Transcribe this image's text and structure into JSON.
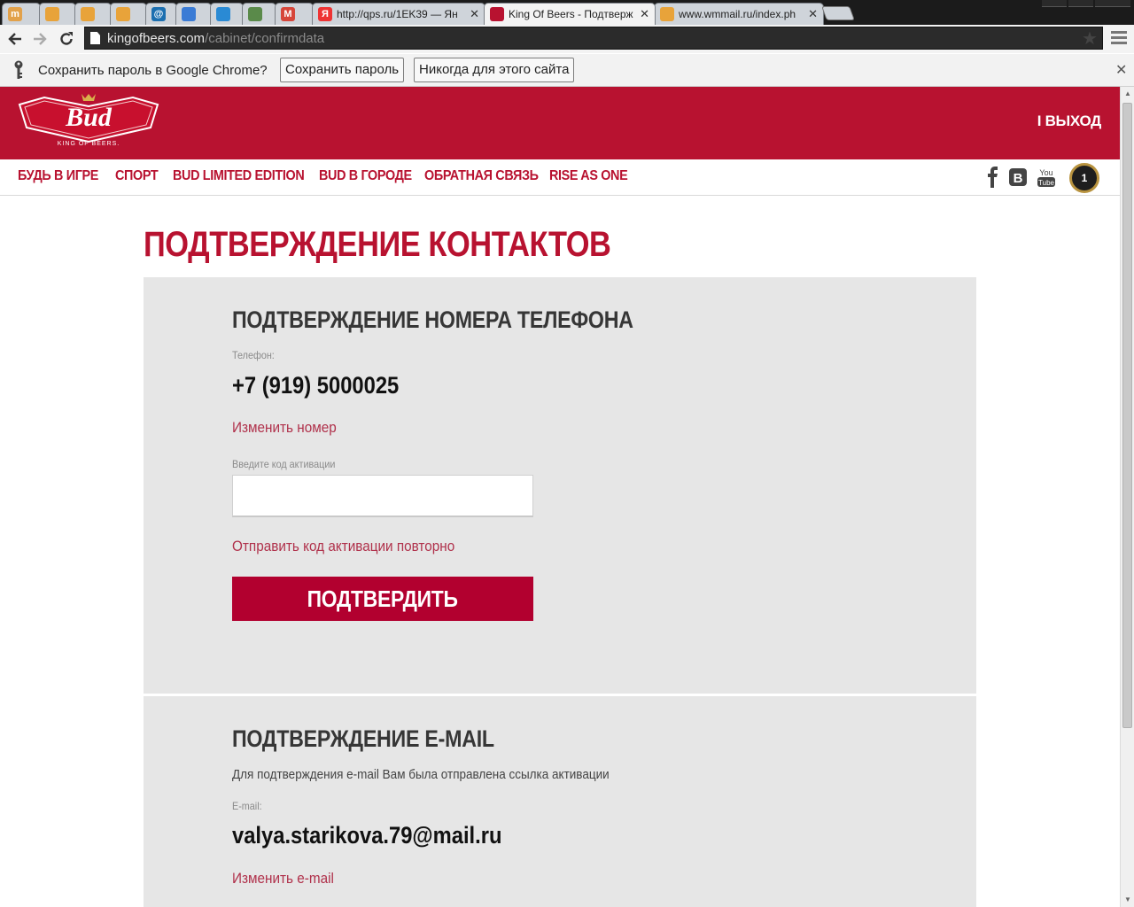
{
  "browser": {
    "tabs": [
      {
        "title": "",
        "icon_color": "#e2a14a",
        "icon_text": "m"
      },
      {
        "title": "",
        "icon_color": "#e8a33a",
        "icon_text": ""
      },
      {
        "title": "",
        "icon_color": "#e8a33a",
        "icon_text": ""
      },
      {
        "title": "",
        "icon_color": "#e8a33a",
        "icon_text": ""
      },
      {
        "title": "",
        "icon_color": "#1c6fb0",
        "icon_text": "@"
      },
      {
        "title": "",
        "icon_color": "#3a7bd5",
        "icon_text": ""
      },
      {
        "title": "",
        "icon_color": "#2a8ad4",
        "icon_text": ""
      },
      {
        "title": "",
        "icon_color": "#5a8a4a",
        "icon_text": ""
      },
      {
        "title": "",
        "icon_color": "#d6463a",
        "icon_text": "M"
      },
      {
        "title": "http://qps.ru/1EK39 — Ян",
        "icon_color": "#e33",
        "icon_text": "Я"
      },
      {
        "title": "King Of Beers - Подтверж",
        "icon_color": "#b81230",
        "icon_text": ""
      },
      {
        "title": "www.wmmail.ru/index.ph",
        "icon_color": "#e8a33a",
        "icon_text": ""
      }
    ],
    "address": {
      "host": "kingofbeers.com",
      "path": "/cabinet/confirmdata"
    },
    "infobar": {
      "message": "Сохранить пароль в Google Chrome?",
      "save_label": "Сохранить пароль",
      "never_label": "Никогда для этого сайта"
    }
  },
  "site": {
    "logo_text": "Bud",
    "logo_tagline": "KING OF BEERS.",
    "logout_label": "I ВЫХОД",
    "nav": [
      "БУДЬ В ИГРЕ",
      "СПОРТ",
      "BUD LIMITED EDITION",
      "BUD В ГОРОДЕ",
      "ОБРАТНАЯ СВЯЗЬ",
      "RISE AS ONE"
    ],
    "social": {
      "vk_letter": "В",
      "youtube_top": "You",
      "youtube_bottom": "Tube"
    },
    "badge_count": "1",
    "brand_color": "#b81230"
  },
  "main": {
    "page_title": "ПОДТВЕРЖДЕНИЕ КОНТАКТОВ",
    "phone": {
      "title": "ПОДТВЕРЖДЕНИЕ НОМЕРА ТЕЛЕФОНА",
      "label": "Телефон:",
      "value": "+7 (919) 5000025",
      "change_link": "Изменить номер",
      "code_label": "Введите код активации",
      "code_value": "",
      "resend_link": "Отправить код активации повторно",
      "confirm_label": "ПОДТВЕРДИТЬ"
    },
    "email": {
      "title": "ПОДТВЕРЖДЕНИЕ E-MAIL",
      "description": "Для подтверждения e-mail Вам была отправлена ссылка активации",
      "label": "E-mail:",
      "value": "valya.starikova.79@mail.ru",
      "change_link": "Изменить e-mail"
    }
  }
}
